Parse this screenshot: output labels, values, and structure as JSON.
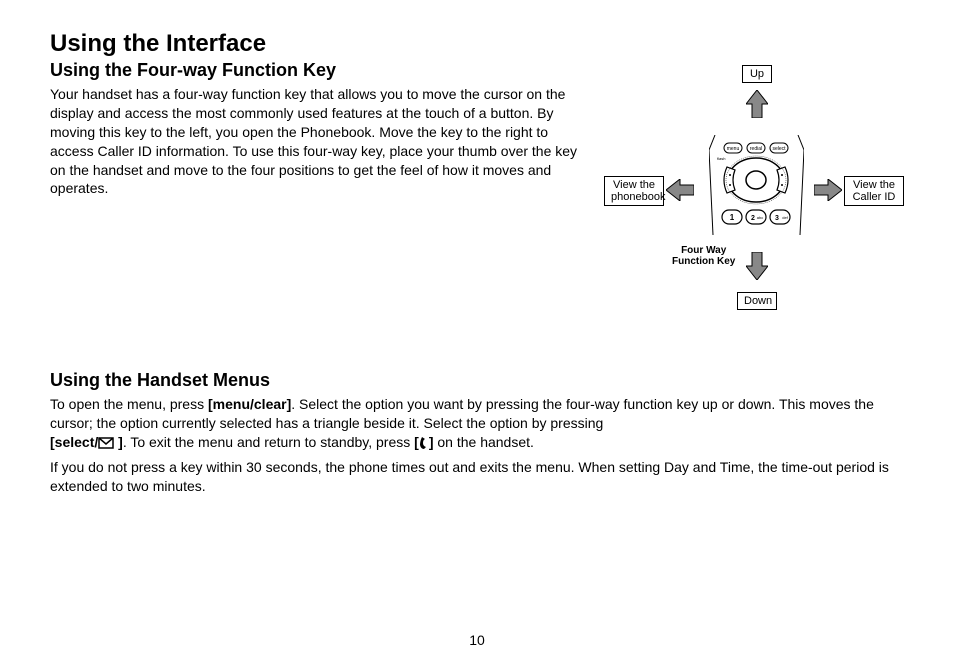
{
  "page_number": "10",
  "title": "Using the Interface",
  "section1": {
    "heading": "Using the Four-way Function Key",
    "body": "Your handset has a four-way function key that allows you to move the cursor on the display and access the most commonly used features at the touch of a button. By moving this key to the left, you open the Phonebook. Move the key to the right to access Caller ID information. To use this four-way key, place your thumb over the key on the handset and move to the four positions to get the feel of how it moves and operates."
  },
  "diagram": {
    "up": "Up",
    "down": "Down",
    "left_line1": "View the",
    "left_line2": "phonebook",
    "right_line1": "View the",
    "right_line2": "Caller ID",
    "fn_label_line1": "Four Way",
    "fn_label_line2": "Function Key",
    "keypad_buttons": [
      "menu",
      "redial",
      "select",
      "flash",
      "1",
      "2abc",
      "3def"
    ]
  },
  "section2": {
    "heading": "Using the Handset Menus",
    "para1_part1": "To open the menu, press ",
    "para1_bold1": "[menu/clear]",
    "para1_part2": ". Select the option you want by pressing the four-way function key up or down. This moves the cursor; the option currently selected has a triangle beside it. Select the option by pressing ",
    "para1_bold2_prefix": "[select/",
    "para1_bold2_suffix": " ]",
    "para1_part3": ". To exit the menu and return to standby, press ",
    "para1_bold3_prefix": "[",
    "para1_bold3_suffix": "]",
    "para1_part4": " on the handset.",
    "para2": "If you do not press a key within 30 seconds, the phone times out and exits the menu. When setting Day and Time, the time-out period is extended to two minutes."
  }
}
